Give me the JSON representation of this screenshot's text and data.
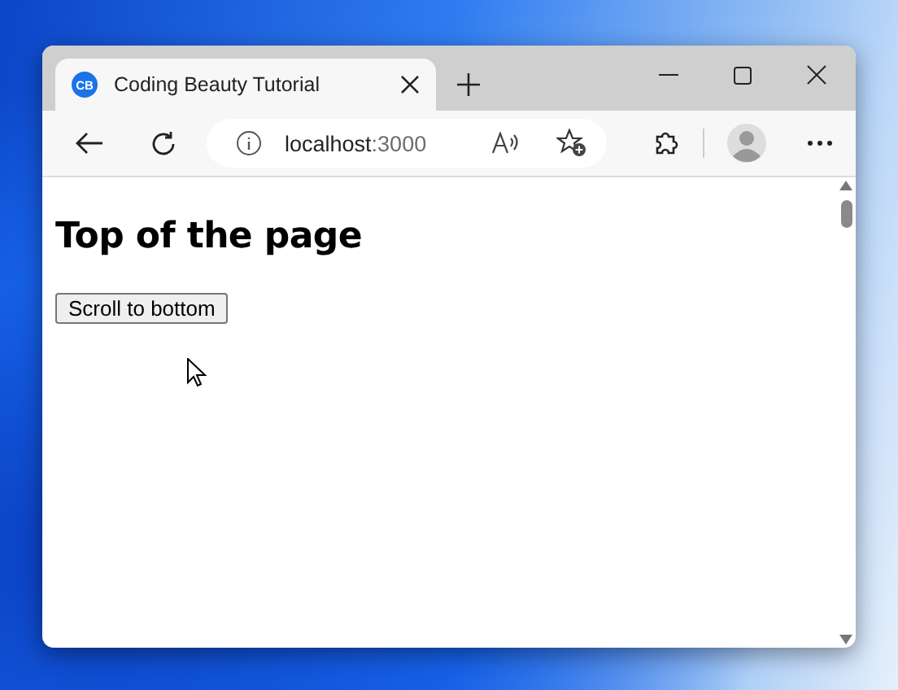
{
  "tab": {
    "favicon": "CB",
    "title": "Coding Beauty Tutorial",
    "selected": true
  },
  "address": {
    "host": "localhost",
    "port": ":3000"
  },
  "page": {
    "heading": "Top of the page",
    "button": "Scroll to bottom"
  }
}
